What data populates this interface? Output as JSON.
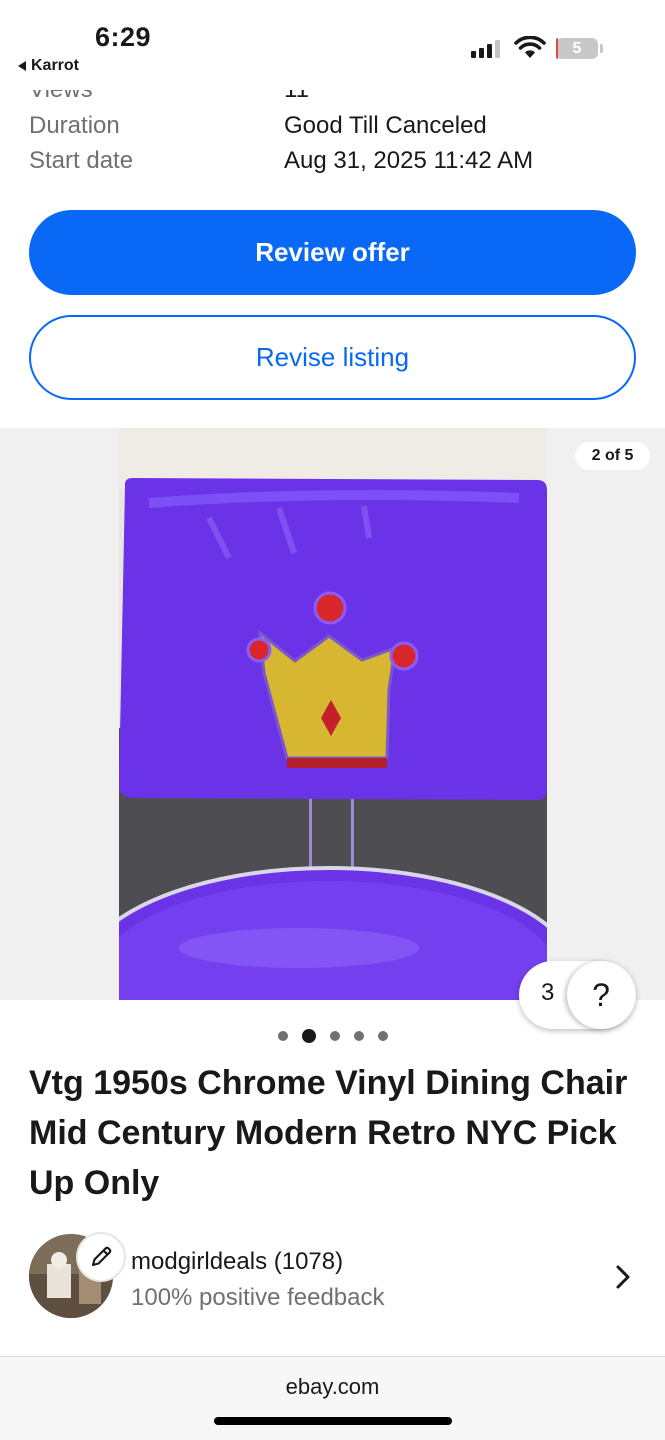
{
  "status_bar": {
    "time": "6:29",
    "back_app": "Karrot",
    "battery": "5",
    "battery_level": 0.05
  },
  "listing_details": {
    "rows": [
      {
        "label": "Views",
        "value": "11"
      },
      {
        "label": "Duration",
        "value": "Good Till Canceled"
      },
      {
        "label": "Start date",
        "value": "Aug 31, 2025 11:42 AM"
      }
    ]
  },
  "actions": {
    "review_offer": "Review offer",
    "revise_listing": "Revise listing"
  },
  "gallery": {
    "counter": "2 of 5",
    "current": 2,
    "total": 5
  },
  "floating": {
    "count": "3",
    "help": "?"
  },
  "item": {
    "title": "Vtg 1950s Chrome Vinyl Dining Chair Mid Century Modern Retro NYC Pick Up Only"
  },
  "seller": {
    "name": "modgirldeals (1078)",
    "feedback": "100% positive feedback"
  },
  "browser": {
    "url": "ebay.com"
  },
  "colors": {
    "primary": "#0968f6",
    "text": "#191919",
    "muted": "#707070",
    "chair_vinyl": "#6a33e8",
    "crown_gold": "#d7b632",
    "jewel_red": "#d9262c"
  },
  "icons": [
    "back-triangle-icon",
    "cellular-signal-icon",
    "wifi-icon",
    "battery-icon",
    "help-icon",
    "pencil-icon",
    "chevron-right-icon"
  ]
}
